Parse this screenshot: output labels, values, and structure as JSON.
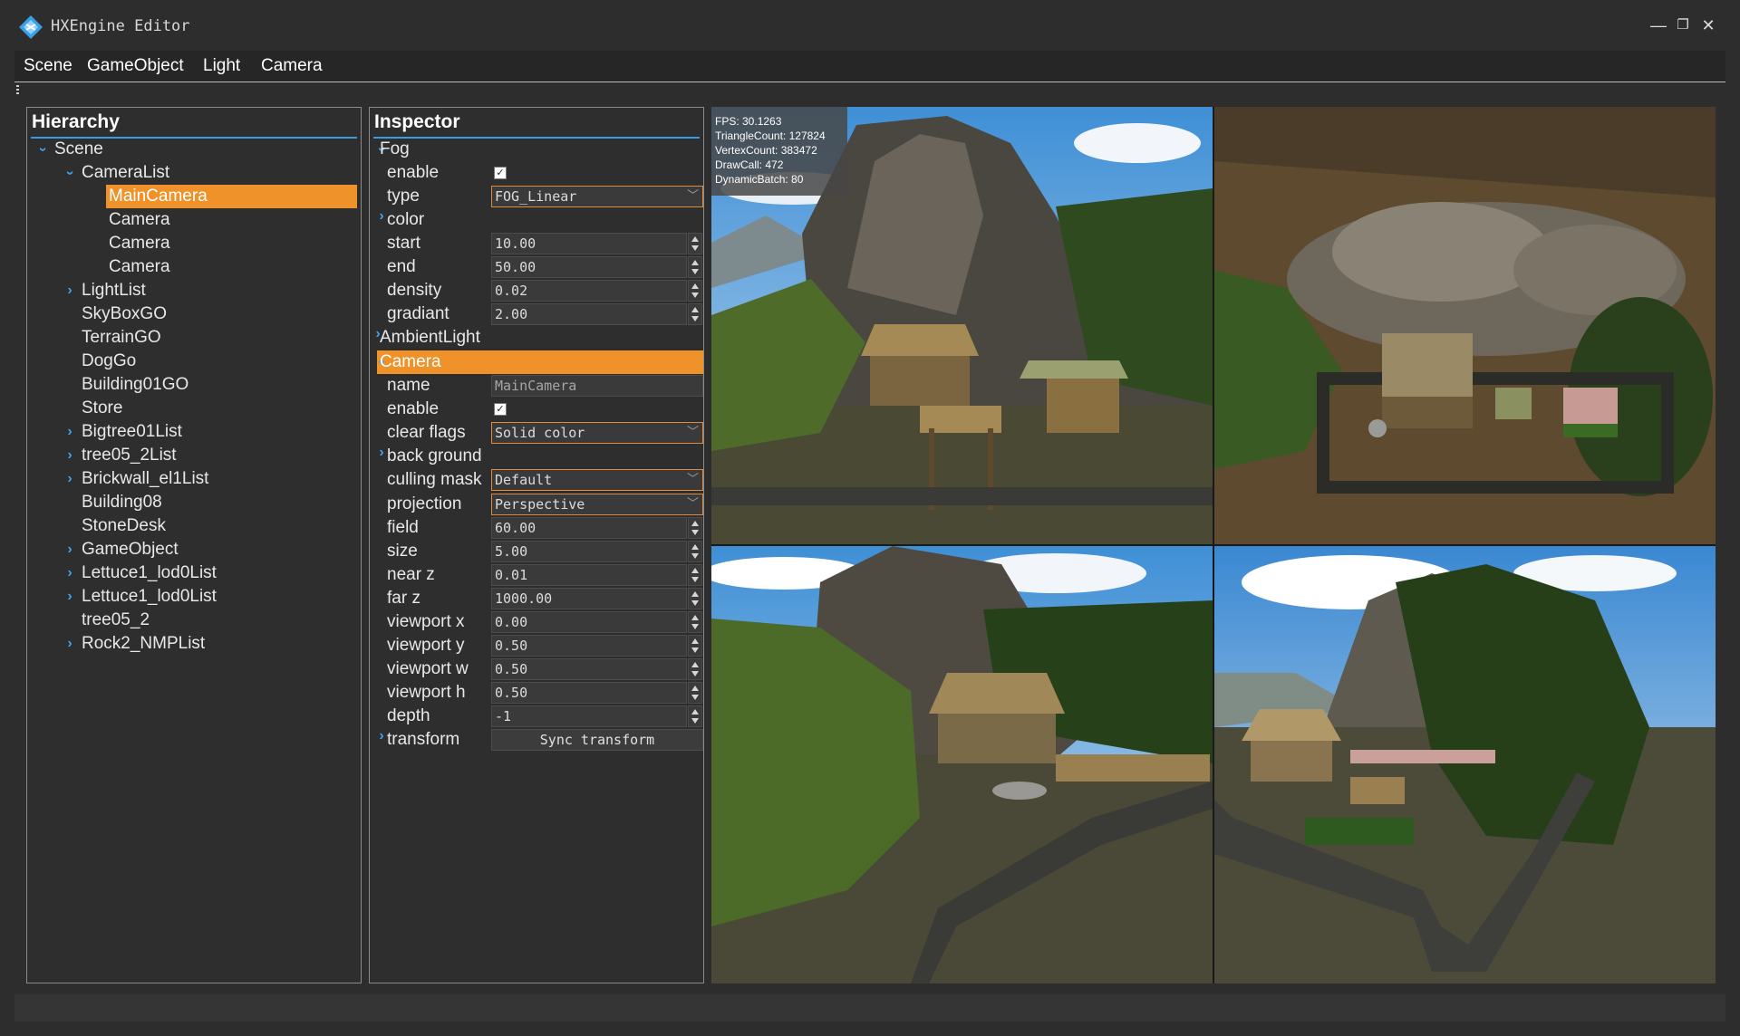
{
  "app": {
    "title": "HXEngine Editor"
  },
  "window_controls": {
    "minimize": "—",
    "maximize": "❐",
    "close": "✕"
  },
  "menu": [
    "Scene",
    "GameObject",
    "Light",
    "Camera"
  ],
  "hierarchy": {
    "title": "Hierarchy",
    "items": [
      {
        "label": "Scene",
        "level": 0,
        "expand": "down"
      },
      {
        "label": "CameraList",
        "level": 1,
        "expand": "down"
      },
      {
        "label": "MainCamera",
        "level": 2,
        "expand": "none",
        "selected": true
      },
      {
        "label": "Camera",
        "level": 2,
        "expand": "none"
      },
      {
        "label": "Camera",
        "level": 2,
        "expand": "none"
      },
      {
        "label": "Camera",
        "level": 2,
        "expand": "none"
      },
      {
        "label": "LightList",
        "level": 1,
        "expand": "right"
      },
      {
        "label": "SkyBoxGO",
        "level": 1,
        "expand": "none"
      },
      {
        "label": "TerrainGO",
        "level": 1,
        "expand": "none"
      },
      {
        "label": "DogGo",
        "level": 1,
        "expand": "none"
      },
      {
        "label": "Building01GO",
        "level": 1,
        "expand": "none"
      },
      {
        "label": "Store",
        "level": 1,
        "expand": "none"
      },
      {
        "label": "Bigtree01List",
        "level": 1,
        "expand": "right"
      },
      {
        "label": "tree05_2List",
        "level": 1,
        "expand": "right"
      },
      {
        "label": "Brickwall_el1List",
        "level": 1,
        "expand": "right"
      },
      {
        "label": "Building08",
        "level": 1,
        "expand": "none"
      },
      {
        "label": "StoneDesk",
        "level": 1,
        "expand": "none"
      },
      {
        "label": "GameObject",
        "level": 1,
        "expand": "right"
      },
      {
        "label": "Lettuce1_lod0List",
        "level": 1,
        "expand": "right"
      },
      {
        "label": "Lettuce1_lod0List",
        "level": 1,
        "expand": "right"
      },
      {
        "label": "tree05_2",
        "level": 1,
        "expand": "none"
      },
      {
        "label": "Rock2_NMPList",
        "level": 1,
        "expand": "right"
      }
    ]
  },
  "inspector": {
    "title": "Inspector",
    "fog": {
      "section": "Fog",
      "enable_label": "enable",
      "enable": true,
      "type_label": "type",
      "type": "FOG_Linear",
      "color_label": "color",
      "start_label": "start",
      "start": "10.00",
      "end_label": "end",
      "end": "50.00",
      "density_label": "density",
      "density": "0.02",
      "gradiant_label": "gradiant",
      "gradiant": "2.00"
    },
    "ambient": {
      "section": "AmbientLight"
    },
    "camera": {
      "section": "Camera",
      "name_label": "name",
      "name": "MainCamera",
      "enable_label": "enable",
      "enable": true,
      "clear_flags_label": "clear flags",
      "clear_flags": "Solid color",
      "background_label": "back ground",
      "culling_mask_label": "culling mask",
      "culling_mask": "Default",
      "projection_label": "projection",
      "projection": "Perspective",
      "field_label": "field",
      "field": "60.00",
      "size_label": "size",
      "size": "5.00",
      "near_label": "near z",
      "near": "0.01",
      "far_label": "far z",
      "far": "1000.00",
      "vx_label": "viewport x",
      "vx": "0.00",
      "vy_label": "viewport y",
      "vy": "0.50",
      "vw_label": "viewport w",
      "vw": "0.50",
      "vh_label": "viewport h",
      "vh": "0.50",
      "depth_label": "depth",
      "depth": "-1",
      "transform_label": "transform",
      "sync_button": "Sync transform"
    }
  },
  "stats": {
    "fps": "FPS: 30.1263",
    "triangles": "TriangleCount: 127824",
    "vertices": "VertexCount: 383472",
    "drawcall": "DrawCall: 472",
    "batch": "DynamicBatch: 80"
  },
  "colors": {
    "accent": "#f0922a",
    "highlight": "#3b9be0",
    "panel": "#2e2e2e"
  }
}
